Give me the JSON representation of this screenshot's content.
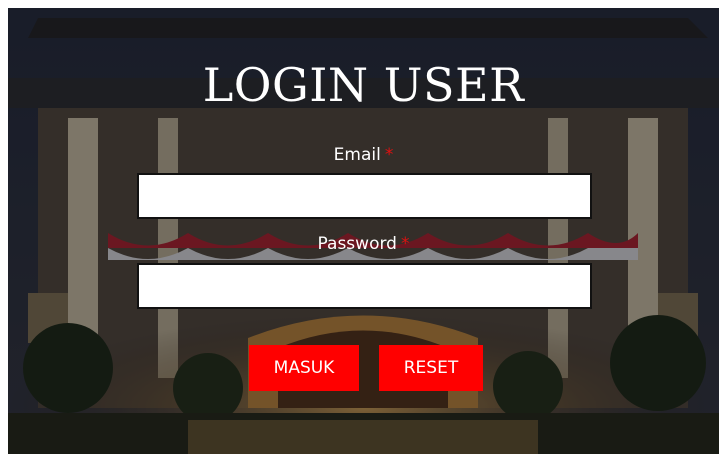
{
  "title": "LOGIN USER",
  "form": {
    "email_label": "Email",
    "email_required": "*",
    "email_value": "",
    "password_label": "Password",
    "password_required": "*",
    "password_value": ""
  },
  "buttons": {
    "submit_label": "MASUK",
    "reset_label": "RESET"
  },
  "colors": {
    "button": "#ff0000",
    "required_mark": "#e01010",
    "text": "#ffffff"
  }
}
